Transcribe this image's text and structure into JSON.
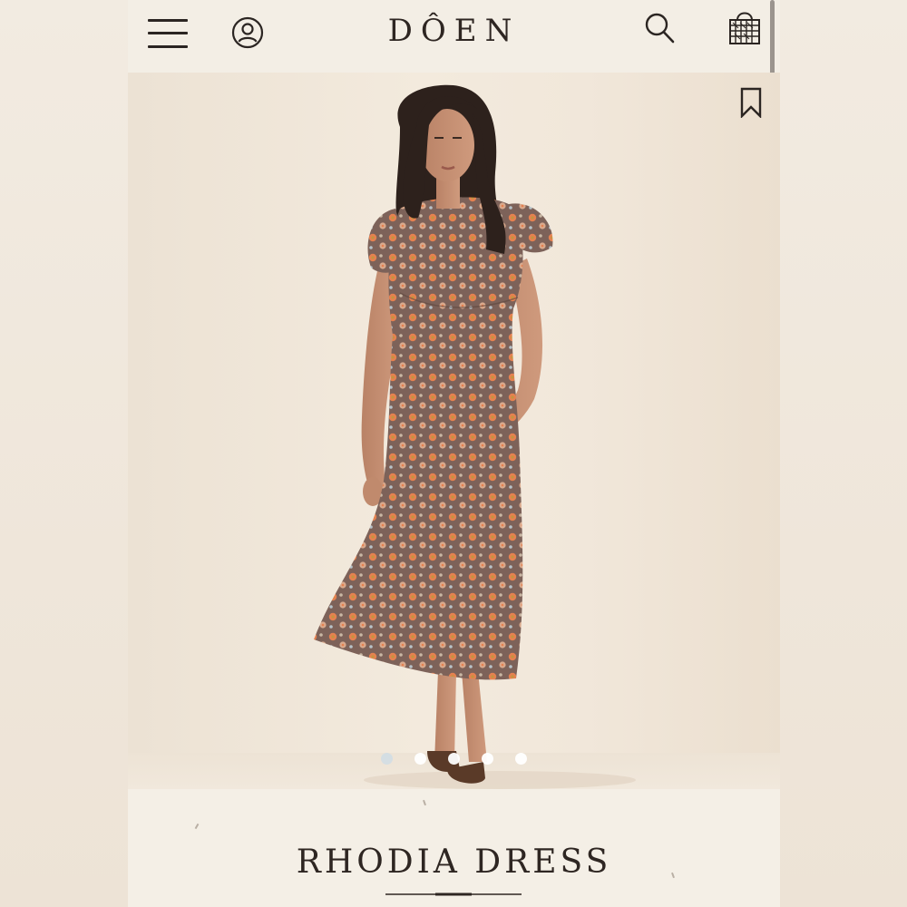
{
  "header": {
    "logo": "DÔEN"
  },
  "product": {
    "title": "RHODIA DRESS",
    "image_count": 5,
    "active_image_index": 0
  },
  "colors": {
    "background": "#f4efe6",
    "text": "#2e2622",
    "dress_base": "#7a5f57",
    "dress_flower": "#e07a4b"
  },
  "icons": {
    "menu": "hamburger-icon",
    "account": "account-icon",
    "search": "search-icon",
    "cart": "basket-icon",
    "save": "bookmark-icon"
  }
}
